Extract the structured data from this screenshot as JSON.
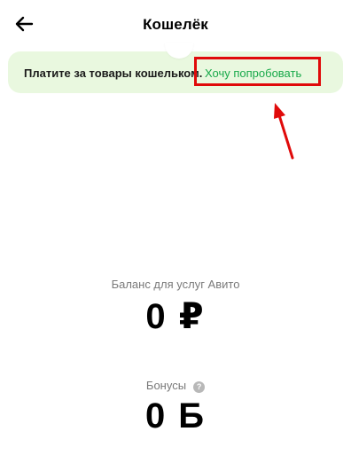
{
  "header": {
    "title": "Кошелёк",
    "back_icon": "arrow-left-icon"
  },
  "promo": {
    "text": "Платите за товары кошельком",
    "separator": ".",
    "link": "Хочу попробовать",
    "background": "#e9f8df",
    "link_color": "#18a94a"
  },
  "annotation": {
    "highlight_color": "#e00a0a"
  },
  "balance": {
    "label": "Баланс для услуг Авито",
    "value": "0 ₽"
  },
  "bonuses": {
    "label": "Бонусы",
    "help_icon": "question-circle-icon",
    "help_glyph": "?",
    "value": "0 Б"
  }
}
